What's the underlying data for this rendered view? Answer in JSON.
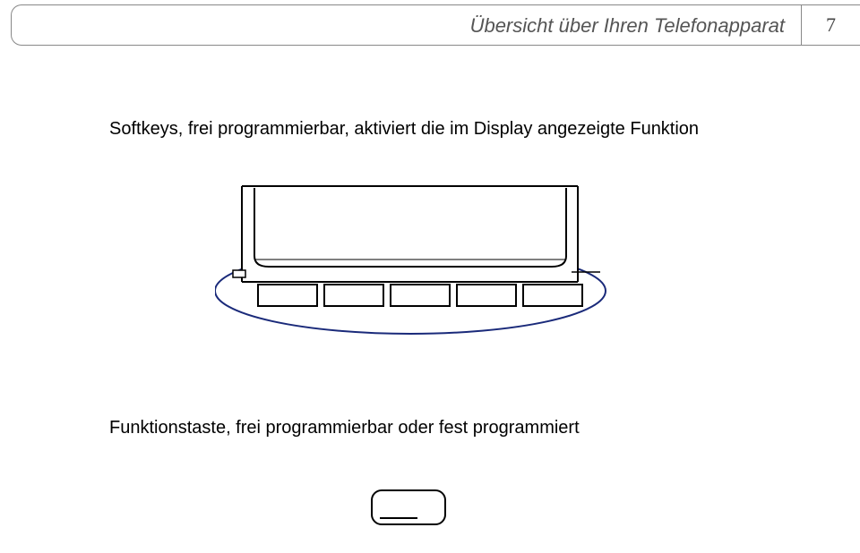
{
  "header": {
    "title": "Übersicht über Ihren Telefonapparat",
    "page_number": "7"
  },
  "text": {
    "softkeys": "Softkeys, frei programmierbar, aktiviert die im Display angezeigte Funktion",
    "funktionstaste": "Funktionstaste, frei programmierbar oder fest programmiert"
  }
}
